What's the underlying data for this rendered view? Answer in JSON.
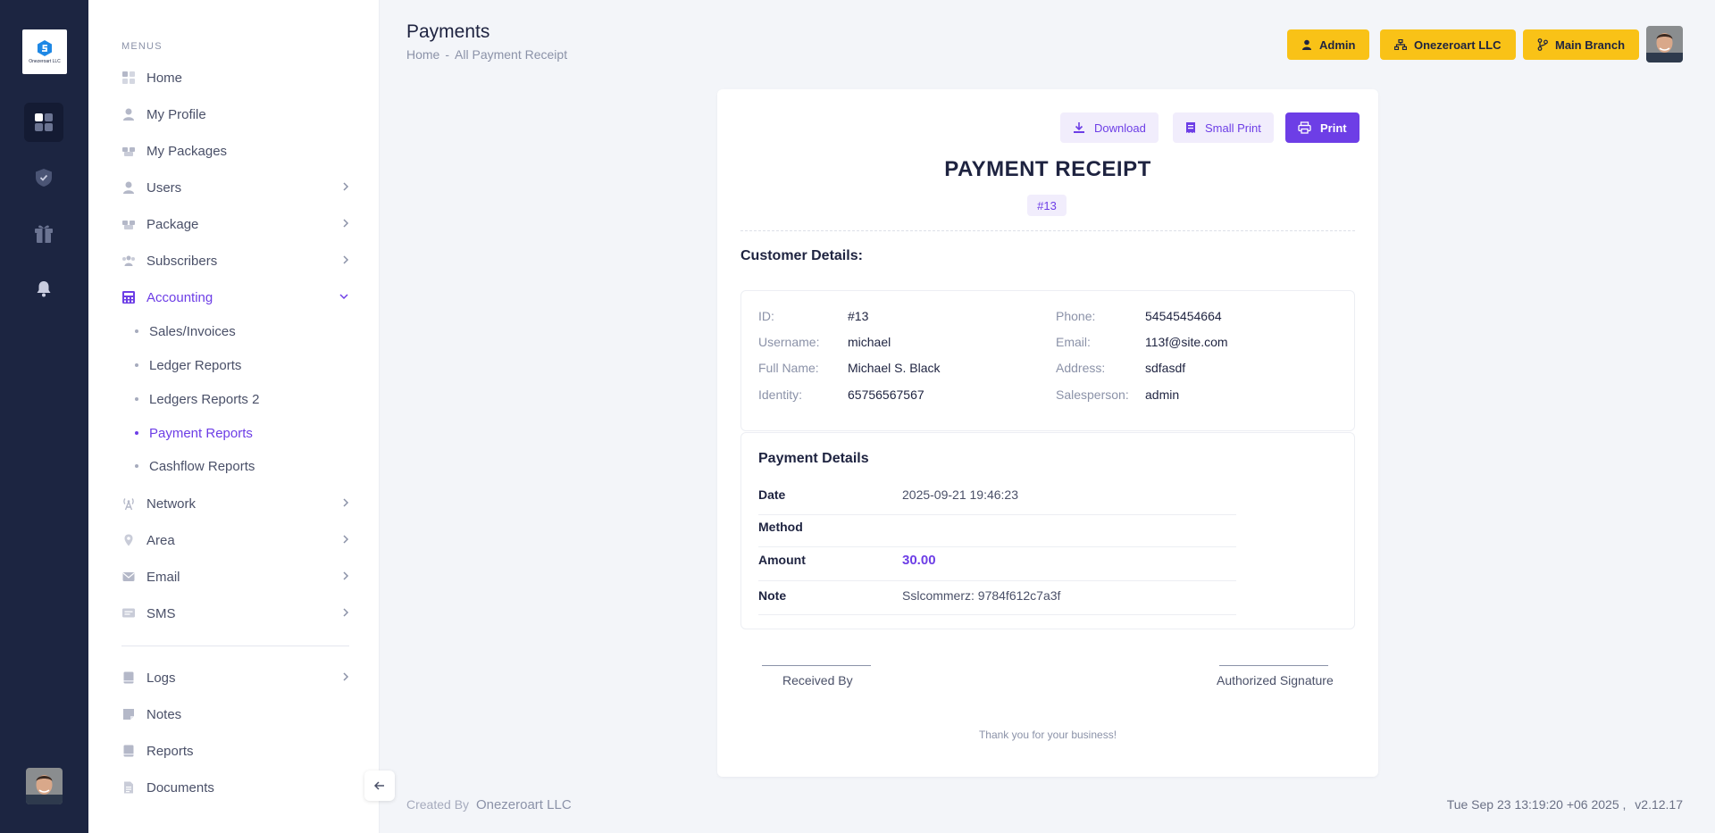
{
  "brand": {
    "logo_text": "Onezeroart LLC"
  },
  "sidebar": {
    "section_label": "MENUS",
    "items": [
      {
        "label": "Home"
      },
      {
        "label": "My Profile"
      },
      {
        "label": "My Packages"
      },
      {
        "label": "Users"
      },
      {
        "label": "Package"
      },
      {
        "label": "Subscribers"
      },
      {
        "label": "Accounting"
      },
      {
        "label": "Network"
      },
      {
        "label": "Area"
      },
      {
        "label": "Email"
      },
      {
        "label": "SMS"
      },
      {
        "label": "Logs"
      },
      {
        "label": "Notes"
      },
      {
        "label": "Reports"
      },
      {
        "label": "Documents"
      }
    ],
    "accounting_sub": [
      {
        "label": "Sales/Invoices"
      },
      {
        "label": "Ledger Reports"
      },
      {
        "label": "Ledgers Reports 2"
      },
      {
        "label": "Payment Reports"
      },
      {
        "label": "Cashflow Reports"
      }
    ]
  },
  "header": {
    "title": "Payments",
    "breadcrumb": {
      "home": "Home",
      "separator": "-",
      "current": "All Payment Receipt"
    },
    "buttons": {
      "admin": "Admin",
      "company": "Onezeroart LLC",
      "branch": "Main Branch"
    }
  },
  "receipt": {
    "actions": {
      "download": "Download",
      "small_print": "Small Print",
      "print": "Print"
    },
    "title": "PAYMENT RECEIPT",
    "number": "#13",
    "customer_heading": "Customer Details:",
    "customer": {
      "id_label": "ID:",
      "id_value": "#13",
      "username_label": "Username:",
      "username_value": "michael",
      "fullname_label": "Full Name:",
      "fullname_value": "Michael S. Black",
      "identity_label": "Identity:",
      "identity_value": "65756567567",
      "phone_label": "Phone:",
      "phone_value": "54545454664",
      "email_label": "Email:",
      "email_value": "113f@site.com",
      "address_label": "Address:",
      "address_value": "sdfasdf",
      "salesperson_label": "Salesperson:",
      "salesperson_value": "admin"
    },
    "payment_heading": "Payment Details",
    "payment": {
      "date_label": "Date",
      "date_value": "2025-09-21 19:46:23",
      "method_label": "Method",
      "method_value": "",
      "amount_label": "Amount",
      "amount_value": "30.00",
      "note_label": "Note",
      "note_value": "Sslcommerz: 9784f612c7a3f"
    },
    "signatures": {
      "received": "Received By",
      "authorized": "Authorized Signature"
    },
    "thanks": "Thank you for your business!"
  },
  "footer": {
    "created_by": "Created By",
    "company": "Onezeroart LLC",
    "datetime": "Tue Sep 23 13:19:20 +06 2025 ,",
    "version": "v2.12.17"
  },
  "colors": {
    "accent": "#6d3ee6",
    "rail_bg": "#1c2541",
    "header_button": "#f9c217",
    "page_bg": "#f3f5f9"
  }
}
